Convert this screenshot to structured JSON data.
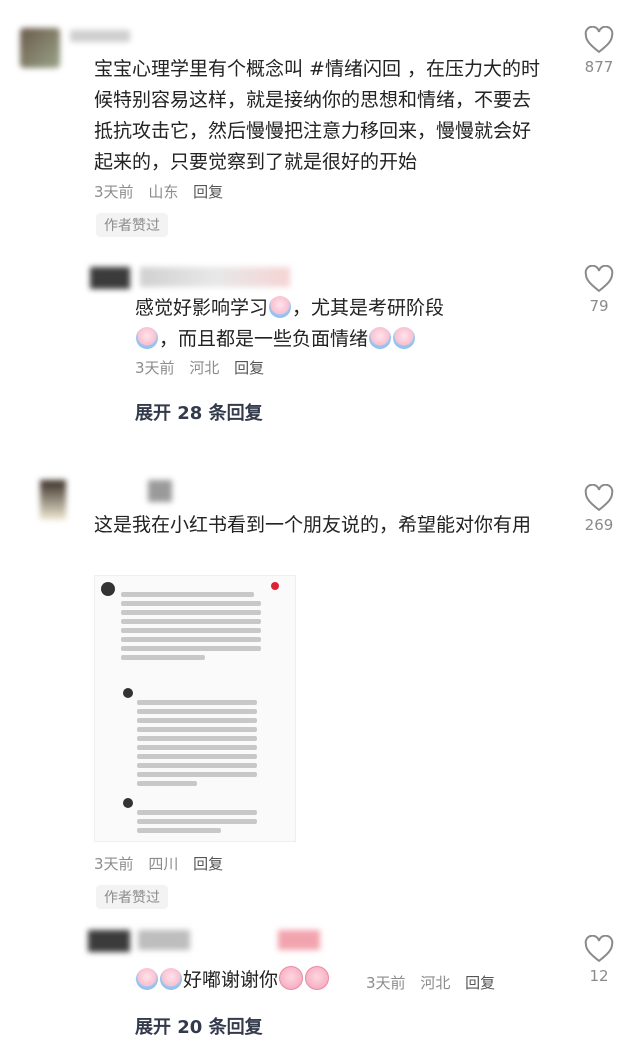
{
  "comments": [
    {
      "text": "宝宝心理学里有个概念叫 #情绪闪回 ，在压力大的时候特别容易这样，就是接纳你的思想和情绪，不要去抵抗攻击它，然后慢慢把注意力移回来，慢慢就会好起来的，只要觉察到了就是很好的开始",
      "time": "3天前",
      "location": "山东",
      "reply": "回复",
      "author_badge": "作者赞过",
      "likes": "877"
    },
    {
      "text_part1": "感觉好影响学习",
      "text_part2": "，尤其是考研阶段",
      "text_part3": "，而且都是一些负面情绪",
      "time": "3天前",
      "location": "河北",
      "reply": "回复",
      "likes": "79",
      "expand": "展开 28 条回复"
    },
    {
      "text": "这是我在小红书看到一个朋友说的，希望能对你有用",
      "time": "3天前",
      "location": "四川",
      "reply": "回复",
      "author_badge": "作者赞过",
      "likes": "269"
    },
    {
      "text": "好嘟谢谢你",
      "time": "3天前",
      "location": "河北",
      "reply": "回复",
      "likes": "12",
      "expand": "展开 20 条回复"
    }
  ],
  "icons": {
    "like": "heart-outline-icon",
    "emoji_sad": "sad-face-emoji-icon",
    "emoji_pig": "pig-face-emoji-icon"
  },
  "colors": {
    "meta": "#8c8c8c",
    "expand": "#333a4c",
    "like": "#8a8a8a"
  }
}
